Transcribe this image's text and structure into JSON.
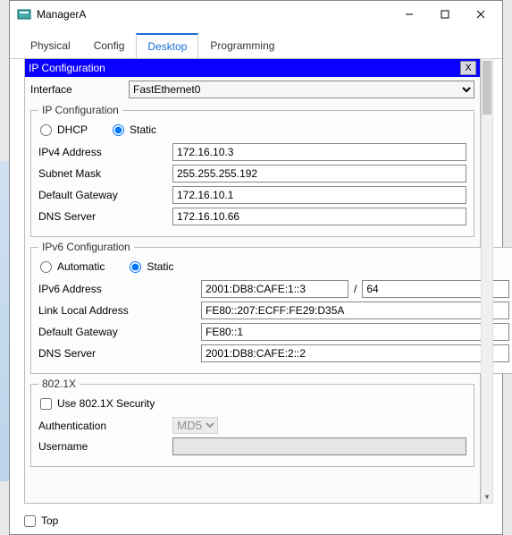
{
  "window": {
    "title": "ManagerA"
  },
  "tabs": {
    "physical": "Physical",
    "config": "Config",
    "desktop": "Desktop",
    "programming": "Programming"
  },
  "panel": {
    "title": "IP Configuration",
    "close": "X"
  },
  "interface": {
    "label": "Interface",
    "value": "FastEthernet0"
  },
  "ipv4": {
    "legend": "IP Configuration",
    "dhcp": "DHCP",
    "static": "Static",
    "addr_label": "IPv4 Address",
    "addr": "172.16.10.3",
    "mask_label": "Subnet Mask",
    "mask": "255.255.255.192",
    "gw_label": "Default Gateway",
    "gw": "172.16.10.1",
    "dns_label": "DNS Server",
    "dns": "172.16.10.66"
  },
  "ipv6": {
    "legend": "IPv6 Configuration",
    "auto": "Automatic",
    "static": "Static",
    "addr_label": "IPv6 Address",
    "addr": "2001:DB8:CAFE:1::3",
    "prefix": "64",
    "ll_label": "Link Local Address",
    "ll": "FE80::207:ECFF:FE29:D35A",
    "gw_label": "Default Gateway",
    "gw": "FE80::1",
    "dns_label": "DNS Server",
    "dns": "2001:DB8:CAFE:2::2"
  },
  "dot1x": {
    "legend": "802.1X",
    "use": "Use 802.1X Security",
    "auth_label": "Authentication",
    "auth_value": "MD5",
    "user_label": "Username"
  },
  "footer": {
    "top": "Top"
  }
}
